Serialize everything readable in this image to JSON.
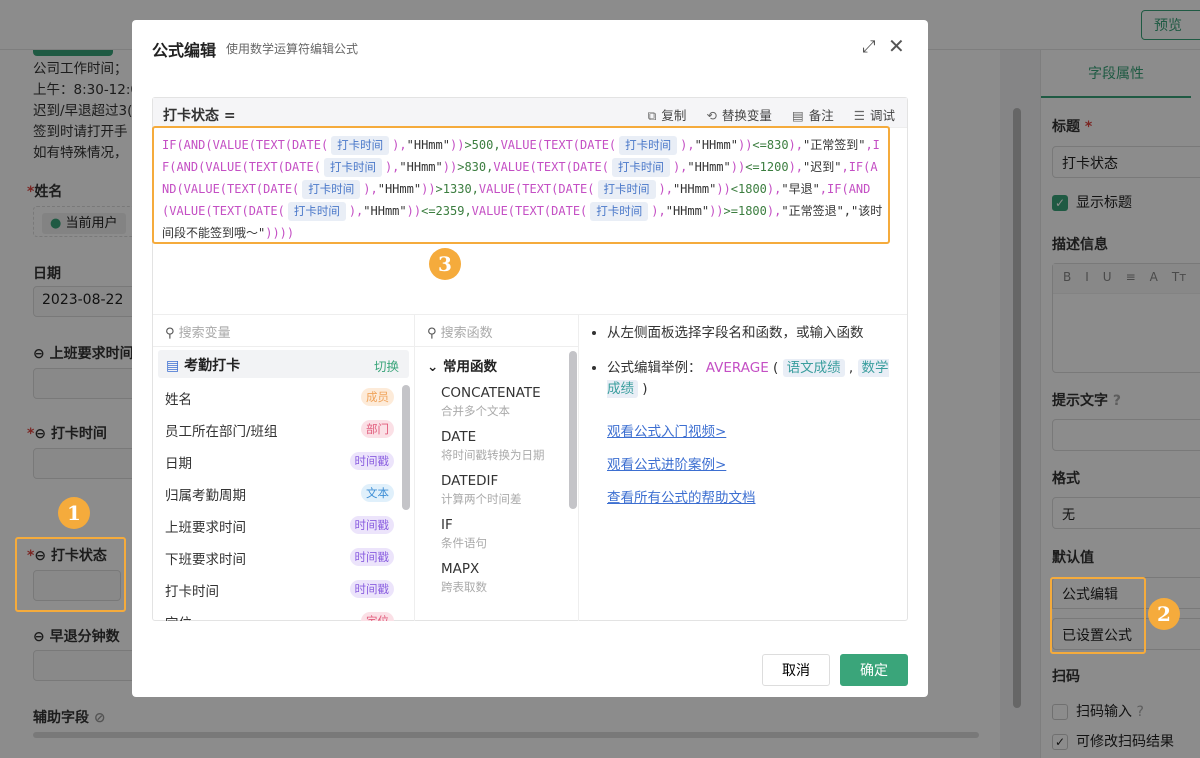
{
  "topbar": {
    "preview": "预览"
  },
  "form": {
    "notice": [
      "公司工作时间；",
      "上午：8:30-12:0",
      "迟到/早退超过3(",
      "签到时请打开手",
      "如有特殊情况，"
    ],
    "name_label": "姓名",
    "name_value": "当前用户",
    "date_label": "日期",
    "date_value": "2023-08-22",
    "start_label": "上班要求时间",
    "punch_label": "打卡时间",
    "status_label": "打卡状态",
    "early_label": "早退分钟数",
    "aux_label": "辅助字段"
  },
  "right_panel": {
    "tab": "字段属性",
    "title_label": "标题",
    "title_value": "打卡状态",
    "show_title": "显示标题",
    "desc_label": "描述信息",
    "rte": [
      "B",
      "I",
      "U",
      "≡",
      "A",
      "Tт"
    ],
    "hint_label": "提示文字",
    "format_label": "格式",
    "format_value": "无",
    "default_label": "默认值",
    "default_mode": "公式编辑",
    "default_value": "已设置公式",
    "scan_label": "扫码",
    "scan_input": "扫码输入",
    "scan_edit": "可修改扫码结果"
  },
  "modal": {
    "title": "公式编辑",
    "subtitle": "使用数学运算符编辑公式",
    "field_name": "打卡状态 =",
    "tools": [
      {
        "icon": "copy-icon",
        "g": "⧉",
        "label": "复制"
      },
      {
        "icon": "replace-icon",
        "g": "⟲",
        "label": "替换变量"
      },
      {
        "icon": "note-icon",
        "g": "▤",
        "label": "备注"
      },
      {
        "icon": "debug-icon",
        "g": "☰",
        "label": "调试"
      }
    ],
    "formula": [
      [
        "fn",
        "IF(AND(VALUE(TEXT(DATE("
      ],
      [
        "field",
        "打卡时间"
      ],
      [
        "fn",
        "),"
      ],
      [
        "str",
        "\"HHmm\""
      ],
      [
        "fn",
        "))"
      ],
      [
        "num",
        ">500,"
      ],
      [
        "fn",
        "VALUE(TEXT(DATE("
      ],
      [
        "field",
        "打卡时间"
      ],
      [
        "fn",
        "),"
      ],
      [
        "str",
        "\"HHmm\""
      ],
      [
        "fn",
        "))"
      ],
      [
        "num",
        "<=830"
      ],
      [
        "fn",
        "),"
      ],
      [
        "str",
        "\"正常签到\""
      ],
      [
        "fn",
        ",IF(AND(VALUE(TEXT(DATE("
      ],
      [
        "field",
        "打卡时间"
      ],
      [
        "fn",
        "),"
      ],
      [
        "str",
        "\"HHmm\""
      ],
      [
        "fn",
        "))"
      ],
      [
        "num",
        ">830,"
      ],
      [
        "fn",
        "VALUE(TEXT(DATE("
      ],
      [
        "field",
        "打卡时间"
      ],
      [
        "fn",
        "),"
      ],
      [
        "str",
        "\"HHmm\""
      ],
      [
        "fn",
        "))"
      ],
      [
        "num",
        "<=1200"
      ],
      [
        "fn",
        "),"
      ],
      [
        "str",
        "\"迟到\""
      ],
      [
        "fn",
        ",IF(AND(VALUE(TEXT(DATE("
      ],
      [
        "field",
        "打卡时间"
      ],
      [
        "fn",
        "),"
      ],
      [
        "str",
        "\"HHmm\""
      ],
      [
        "fn",
        "))"
      ],
      [
        "num",
        ">1330,"
      ],
      [
        "fn",
        "VALUE(TEXT(DATE("
      ],
      [
        "field",
        "打卡时间"
      ],
      [
        "fn",
        "),"
      ],
      [
        "str",
        "\"HHmm\""
      ],
      [
        "fn",
        "))"
      ],
      [
        "num",
        "<1800"
      ],
      [
        "fn",
        "),"
      ],
      [
        "str",
        "\"早退\""
      ],
      [
        "fn",
        ",IF(AND(VALUE(TEXT(DATE("
      ],
      [
        "field",
        "打卡时间"
      ],
      [
        "fn",
        "),"
      ],
      [
        "str",
        "\"HHmm\""
      ],
      [
        "fn",
        "))"
      ],
      [
        "num",
        "<=2359,"
      ],
      [
        "fn",
        "VALUE(TEXT(DATE("
      ],
      [
        "field",
        "打卡时间"
      ],
      [
        "fn",
        "),"
      ],
      [
        "str",
        "\"HHmm\""
      ],
      [
        "fn",
        "))"
      ],
      [
        "num",
        ">=1800"
      ],
      [
        "fn",
        "),"
      ],
      [
        "str",
        "\"正常签退\",\"该时间段不能签到哦～\""
      ],
      [
        "fn",
        "))))"
      ]
    ],
    "var_search": "搜索变量",
    "fn_search": "搜索函数",
    "form_name": "考勤打卡",
    "switch": "切换",
    "variables": [
      {
        "name": "姓名",
        "tag": "成员",
        "bg": "#fdebd9",
        "fg": "#f0a35a"
      },
      {
        "name": "员工所在部门/班组",
        "tag": "部门",
        "bg": "#fbe0e6",
        "fg": "#e05a7a"
      },
      {
        "name": "日期",
        "tag": "时间戳",
        "bg": "#ece4fb",
        "fg": "#8a5ee0"
      },
      {
        "name": "归属考勤周期",
        "tag": "文本",
        "bg": "#e0f0fb",
        "fg": "#3f8fd6"
      },
      {
        "name": "上班要求时间",
        "tag": "时间戳",
        "bg": "#ece4fb",
        "fg": "#8a5ee0"
      },
      {
        "name": "下班要求时间",
        "tag": "时间戳",
        "bg": "#ece4fb",
        "fg": "#8a5ee0"
      },
      {
        "name": "打卡时间",
        "tag": "时间戳",
        "bg": "#ece4fb",
        "fg": "#8a5ee0"
      },
      {
        "name": "定位",
        "tag": "定位",
        "bg": "#fbe0e6",
        "fg": "#e05a7a"
      }
    ],
    "fn_group": "常用函数",
    "functions": [
      {
        "name": "CONCATENATE",
        "desc": "合并多个文本"
      },
      {
        "name": "DATE",
        "desc": "将时间戳转换为日期"
      },
      {
        "name": "DATEDIF",
        "desc": "计算两个时间差"
      },
      {
        "name": "IF",
        "desc": "条件语句"
      },
      {
        "name": "MAPX",
        "desc": "跨表取数"
      }
    ],
    "help": {
      "tip1": "从左侧面板选择字段名和函数，或输入函数",
      "tip2_prefix": "公式编辑举例：",
      "tip2_fn": "AVERAGE",
      "tip2_f1": "语文成绩",
      "tip2_f2": "数学成绩",
      "links": [
        "观看公式入门视频>",
        "观看公式进阶案例>",
        "查看所有公式的帮助文档"
      ]
    },
    "cancel": "取消",
    "ok": "确定"
  },
  "annotations": [
    "1",
    "2",
    "3"
  ],
  "accent": "#3aa57a",
  "annotation_color": "#f5ab3c"
}
